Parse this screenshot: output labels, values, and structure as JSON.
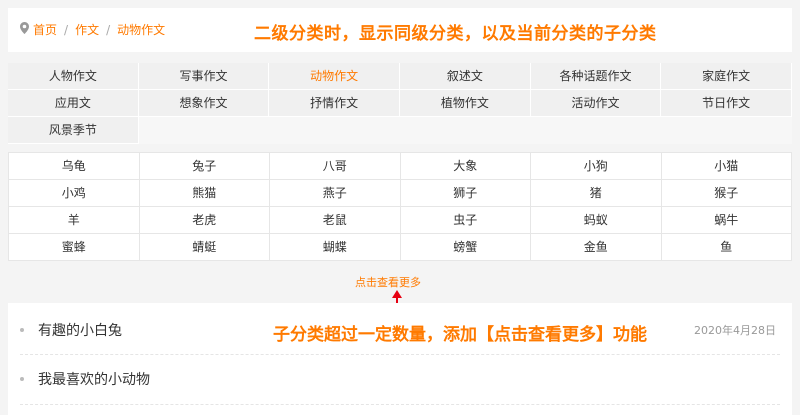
{
  "breadcrumb": {
    "icon": "location-pin-icon",
    "items": [
      "首页",
      "作文",
      "动物作文"
    ],
    "separator": "/"
  },
  "annotations": {
    "top": "二级分类时，显示同级分类，以及当前分类的子分类",
    "bottom": "子分类超过一定数量，添加【点击查看更多】功能"
  },
  "categories": {
    "active": "动物作文",
    "items": [
      "人物作文",
      "写事作文",
      "动物作文",
      "叙述文",
      "各种话题作文",
      "家庭作文",
      "应用文",
      "想象作文",
      "抒情作文",
      "植物作文",
      "活动作文",
      "节日作文",
      "风景季节"
    ]
  },
  "subcategories": [
    "乌龟",
    "兔子",
    "八哥",
    "大象",
    "小狗",
    "小猫",
    "小鸡",
    "熊猫",
    "燕子",
    "狮子",
    "猪",
    "猴子",
    "羊",
    "老虎",
    "老鼠",
    "虫子",
    "蚂蚁",
    "蜗牛",
    "蜜蜂",
    "蜻蜓",
    "蝴蝶",
    "螃蟹",
    "金鱼",
    "鱼"
  ],
  "more_label": "点击查看更多",
  "articles": [
    {
      "title": "有趣的小白兔",
      "date": "2020年4月28日"
    },
    {
      "title": "我最喜欢的小动物",
      "date": ""
    }
  ],
  "colors": {
    "accent": "#ff7a00",
    "arrow": "#e60012"
  }
}
